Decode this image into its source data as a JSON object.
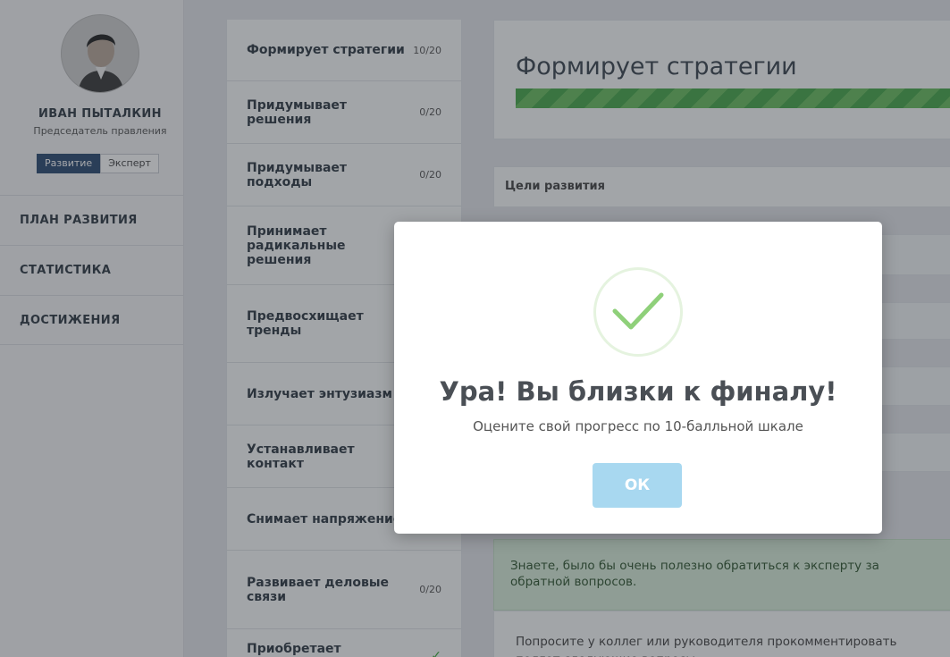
{
  "profile": {
    "name": "ИВАН ПЫТАЛКИН",
    "role": "Председатель правления",
    "modes": [
      "Развитие",
      "Эксперт"
    ]
  },
  "nav": {
    "items": [
      "ПЛАН РАЗВИТИЯ",
      "СТАТИСТИКА",
      "ДОСТИЖЕНИЯ"
    ]
  },
  "skills": [
    {
      "name": "Формирует стратегии",
      "score": "10/20"
    },
    {
      "name": "Придумывает решения",
      "score": "0/20"
    },
    {
      "name": "Придумывает подходы",
      "score": "0/20"
    },
    {
      "name": "Принимает радикальные решения",
      "score": ""
    },
    {
      "name": "Предвосхищает тренды",
      "score": ""
    },
    {
      "name": "Излучает энтузиазм",
      "score": ""
    },
    {
      "name": "Устанавливает контакт",
      "score": ""
    },
    {
      "name": "Снимает напряжение",
      "score": ""
    },
    {
      "name": "Развивает деловые связи",
      "score": "0/20"
    },
    {
      "name": "Приобретает приятелей",
      "score": "✓"
    }
  ],
  "main": {
    "goal_title": "Формирует стратегии",
    "progress": 0.5,
    "panel_header": "Цели развития",
    "tip": "Знаете, было бы очень полезно обратиться к эксперту за обратной вопросов.",
    "hint": "Попросите у коллег или руководителя прокомментировать подгот следующие вопросы:"
  },
  "modal": {
    "title": "Ура! Вы близки к финалу!",
    "subtitle": "Оцените свой прогресс по 10-балльной шкале",
    "ok_label": "ОК",
    "icon": "checkmark-icon"
  },
  "colors": {
    "accent": "#2c4a73",
    "progress": "#48a84a",
    "ok_button": "#a8d8f0",
    "tip_bg": "#d9eedb"
  }
}
